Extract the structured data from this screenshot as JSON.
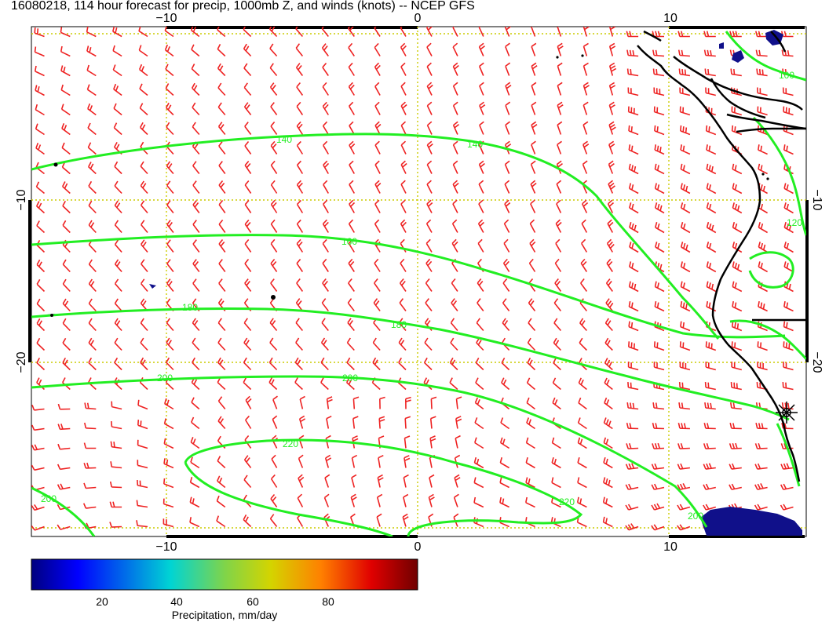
{
  "title": "16080218, 114 hour forecast for precip, 1000mb Z, and winds (knots) -- NCEP GFS",
  "axes": {
    "top_ticks": [
      "−10",
      "0",
      "10"
    ],
    "bottom_ticks": [
      "−10",
      "0",
      "10"
    ],
    "left_ticks": [
      "−10",
      "−20"
    ],
    "right_ticks": [
      "−10",
      "−20"
    ]
  },
  "contours": {
    "labels": [
      "140",
      "140",
      "160",
      "180",
      "180",
      "200",
      "200",
      "200",
      "220",
      "220",
      "100",
      "120",
      "200"
    ],
    "color": "#22ee22"
  },
  "wind_barbs": {
    "color": "#ee2222"
  },
  "colorbar": {
    "label": "Precipitation, mm/day",
    "ticks": [
      "20",
      "40",
      "60",
      "80"
    ],
    "range": [
      0,
      100
    ]
  },
  "colors": {
    "land_outline": "#000000",
    "grid": "#cccc00",
    "precip_low": "#000080"
  }
}
